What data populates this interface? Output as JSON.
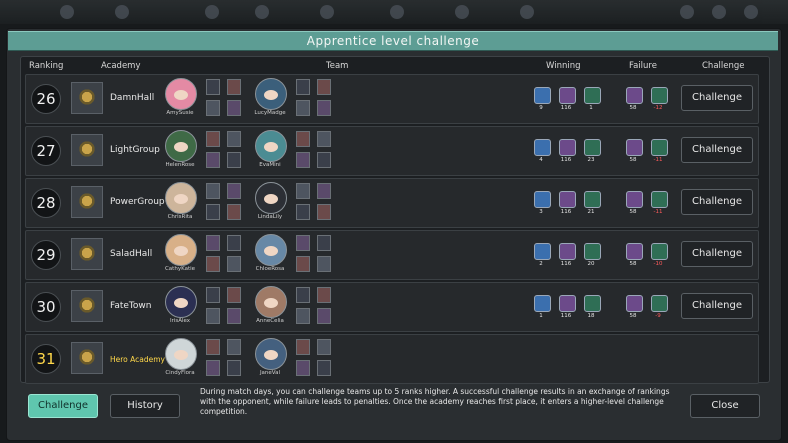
{
  "title": "Apprentice level challenge",
  "headers": {
    "ranking": "Ranking",
    "academy": "Academy",
    "team": "Team",
    "winning": "Winning",
    "failure": "Failure",
    "challenge": "Challenge"
  },
  "rows": [
    {
      "rank": "26",
      "academy": "DamnHall",
      "p1": "AmySusie",
      "p2": "LucyMadge",
      "win": [
        "9",
        "116",
        "1"
      ],
      "fail": [
        "58",
        "-12"
      ],
      "challenge": "Challenge",
      "self": false,
      "c1": "#e48aa4",
      "c2": "#3b5f7b"
    },
    {
      "rank": "27",
      "academy": "LightGroup",
      "p1": "HelenRose",
      "p2": "EvaMini",
      "win": [
        "4",
        "116",
        "23"
      ],
      "fail": [
        "58",
        "-11"
      ],
      "challenge": "Challenge",
      "self": false,
      "c1": "#3f6a46",
      "c2": "#4b8c93"
    },
    {
      "rank": "28",
      "academy": "PowerGroup",
      "p1": "ChrisRita",
      "p2": "LindaLily",
      "win": [
        "3",
        "116",
        "21"
      ],
      "fail": [
        "58",
        "-11"
      ],
      "challenge": "Challenge",
      "self": false,
      "c1": "#cdb59b",
      "c2": "#2c2f35"
    },
    {
      "rank": "29",
      "academy": "SaladHall",
      "p1": "CathyKatie",
      "p2": "ChloeRosa",
      "win": [
        "2",
        "116",
        "20"
      ],
      "fail": [
        "58",
        "-10"
      ],
      "challenge": "Challenge",
      "self": false,
      "c1": "#d8b088",
      "c2": "#6788a6"
    },
    {
      "rank": "30",
      "academy": "FateTown",
      "p1": "IrisAlex",
      "p2": "AnneCelia",
      "win": [
        "1",
        "116",
        "18"
      ],
      "fail": [
        "58",
        "-9"
      ],
      "challenge": "Challenge",
      "self": false,
      "c1": "#2b2f52",
      "c2": "#9f7a66"
    },
    {
      "rank": "31",
      "academy": "Hero Academy",
      "p1": "CindyFlora",
      "p2": "JaneVal",
      "win": [],
      "fail": [],
      "challenge": "",
      "self": true,
      "c1": "#cfd6d8",
      "c2": "#44607f"
    }
  ],
  "buttons": {
    "challenge": "Challenge",
    "history": "History",
    "close": "Close"
  },
  "info": "During match days, you can challenge teams up to 5 ranks higher. A successful challenge results in an exchange of rankings with the opponent, while failure leads to penalties. Once the academy reaches first place, it enters a higher-level challenge competition.",
  "colors": {
    "title_bar": "#5d9d94",
    "accent_button": "#5fc6ae",
    "self_rank": "#ffd84a",
    "penalty": "#ff5b5b"
  }
}
